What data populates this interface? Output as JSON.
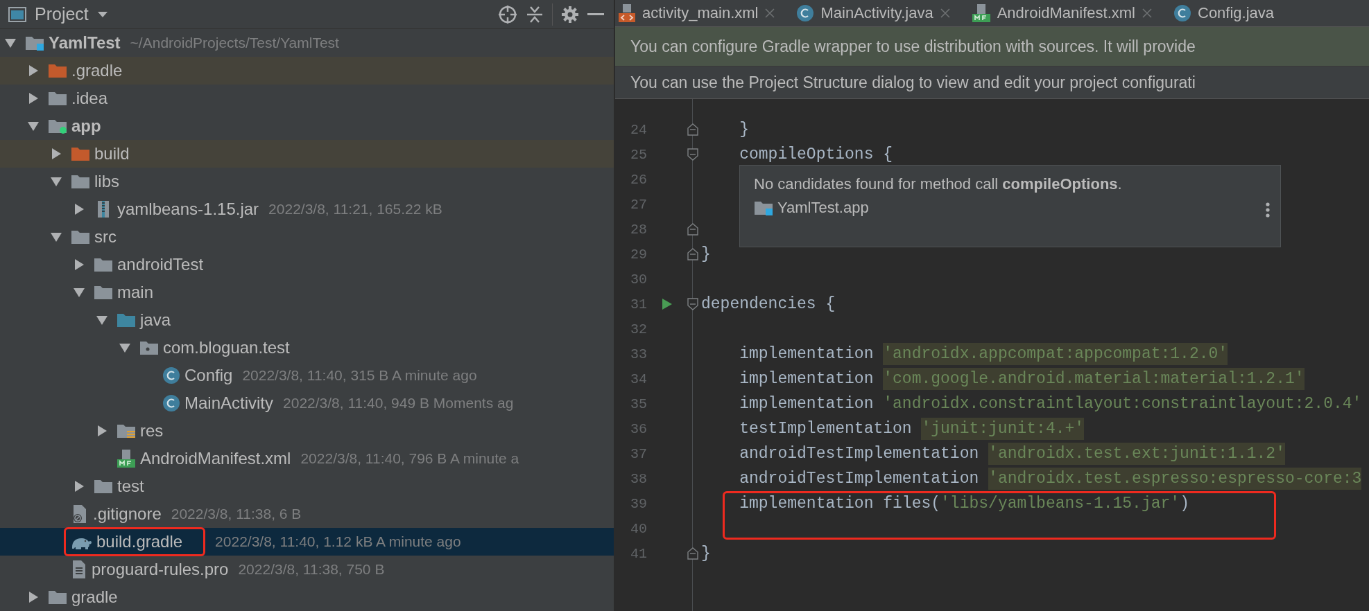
{
  "project_panel": {
    "title": "Project",
    "tree": [
      {
        "name": "YamlTest",
        "detail": "~/AndroidProjects/Test/YamlTest",
        "kind": "project-module",
        "expanded": true,
        "selected": false,
        "marked": false,
        "children": [
          {
            "name": ".gradle",
            "kind": "excluded-folder",
            "expanded": false,
            "selected": false,
            "marked": false
          },
          {
            "name": ".idea",
            "kind": "folder",
            "expanded": false,
            "selected": false,
            "marked": false
          },
          {
            "name": "app",
            "kind": "app-module",
            "expanded": true,
            "selected": false,
            "marked": false,
            "children": [
              {
                "name": "build",
                "kind": "excluded-folder",
                "expanded": false,
                "selected": false,
                "marked": false
              },
              {
                "name": "libs",
                "kind": "folder",
                "expanded": true,
                "selected": false,
                "marked": false,
                "children": [
                  {
                    "name": "yamlbeans-1.15.jar",
                    "detail": "2022/3/8, 11:21, 165.22 kB",
                    "kind": "jar",
                    "expanded": false,
                    "selected": false,
                    "marked": false
                  }
                ]
              },
              {
                "name": "src",
                "kind": "folder",
                "expanded": true,
                "selected": false,
                "marked": false,
                "children": [
                  {
                    "name": "androidTest",
                    "kind": "folder",
                    "expanded": false,
                    "selected": false,
                    "marked": false
                  },
                  {
                    "name": "main",
                    "kind": "folder",
                    "expanded": true,
                    "selected": false,
                    "marked": false,
                    "children": [
                      {
                        "name": "java",
                        "kind": "source-folder",
                        "expanded": true,
                        "selected": false,
                        "marked": false,
                        "children": [
                          {
                            "name": "com.bloguan.test",
                            "kind": "package",
                            "expanded": true,
                            "selected": false,
                            "marked": false,
                            "children": [
                              {
                                "name": "Config",
                                "detail": "2022/3/8, 11:40, 315 B A minute ago",
                                "kind": "class",
                                "selected": false,
                                "marked": false
                              },
                              {
                                "name": "MainActivity",
                                "detail": "2022/3/8, 11:40, 949 B Moments ag",
                                "kind": "class",
                                "selected": false,
                                "marked": false
                              }
                            ]
                          }
                        ]
                      },
                      {
                        "name": "res",
                        "kind": "resource-folder",
                        "expanded": false,
                        "selected": false,
                        "marked": false
                      },
                      {
                        "name": "AndroidManifest.xml",
                        "detail": "2022/3/8, 11:40, 796 B A minute a",
                        "kind": "manifest",
                        "selected": false,
                        "marked": false
                      }
                    ]
                  },
                  {
                    "name": "test",
                    "kind": "folder",
                    "expanded": false,
                    "selected": false,
                    "marked": false
                  }
                ]
              },
              {
                "name": ".gitignore",
                "detail": "2022/3/8, 11:38, 6 B",
                "kind": "ignore-file",
                "selected": false,
                "marked": false
              },
              {
                "name": "build.gradle",
                "detail": "2022/3/8, 11:40, 1.12 kB A minute ago",
                "kind": "gradle",
                "selected": true,
                "marked": true
              },
              {
                "name": "proguard-rules.pro",
                "detail": "2022/3/8, 11:38, 750 B",
                "kind": "text-file",
                "selected": false,
                "marked": false
              }
            ]
          },
          {
            "name": "gradle",
            "kind": "folder",
            "expanded": false,
            "selected": false,
            "marked": false
          }
        ]
      }
    ]
  },
  "editor": {
    "tabs": [
      {
        "label": "activity_main.xml",
        "kind": "xml",
        "closable": true
      },
      {
        "label": "MainActivity.java",
        "kind": "class",
        "closable": true
      },
      {
        "label": "AndroidManifest.xml",
        "kind": "manifest",
        "closable": true
      },
      {
        "label": "Config.java",
        "kind": "class",
        "closable": false
      }
    ],
    "banners": [
      {
        "text": "You can configure Gradle wrapper to use distribution with sources. It will provide",
        "kind": "suggestion"
      },
      {
        "text": "You can use the Project Structure dialog to view and edit your project configurati",
        "kind": "info"
      }
    ],
    "lines": [
      {
        "number": "24",
        "fold_end": true,
        "tokens": [
          {
            "text": "    }",
            "kind": "code"
          }
        ]
      },
      {
        "number": "25",
        "fold_start": true,
        "tokens": [
          {
            "text": "    compileOptions {",
            "kind": "code"
          }
        ]
      },
      {
        "number": "26"
      },
      {
        "number": "27"
      },
      {
        "number": "28",
        "fold_end": true
      },
      {
        "number": "29",
        "fold_end": true,
        "tokens": [
          {
            "text": "}",
            "kind": "code"
          }
        ]
      },
      {
        "number": "30"
      },
      {
        "number": "31",
        "fold_start": true,
        "run": true,
        "tokens": [
          {
            "text": "dependencies {",
            "kind": "code"
          }
        ]
      },
      {
        "number": "32"
      },
      {
        "number": "33",
        "tokens": [
          {
            "text": "    implementation ",
            "kind": "code"
          },
          {
            "text": "'androidx.appcompat:appcompat:1.2.0'",
            "kind": "string-flagged"
          }
        ]
      },
      {
        "number": "34",
        "tokens": [
          {
            "text": "    implementation ",
            "kind": "code"
          },
          {
            "text": "'com.google.android.material:material:1.2.1'",
            "kind": "string-flagged"
          }
        ]
      },
      {
        "number": "35",
        "tokens": [
          {
            "text": "    implementation ",
            "kind": "code"
          },
          {
            "text": "'androidx.constraintlayout:constraintlayout:2.0.4'",
            "kind": "string"
          }
        ]
      },
      {
        "number": "36",
        "tokens": [
          {
            "text": "    testImplementation ",
            "kind": "code"
          },
          {
            "text": "'junit:junit:4.+'",
            "kind": "string-flagged"
          }
        ]
      },
      {
        "number": "37",
        "tokens": [
          {
            "text": "    androidTestImplementation ",
            "kind": "code"
          },
          {
            "text": "'androidx.test.ext:junit:1.1.2'",
            "kind": "string-flagged"
          }
        ]
      },
      {
        "number": "38",
        "tokens": [
          {
            "text": "    androidTestImplementation ",
            "kind": "code"
          },
          {
            "text": "'androidx.test.espresso:espresso-core:3",
            "kind": "string-flagged"
          }
        ]
      },
      {
        "number": "39",
        "marked": true,
        "tokens": [
          {
            "text": "    implementation files(",
            "kind": "code"
          },
          {
            "text": "'libs/yamlbeans-1.15.jar'",
            "kind": "string"
          },
          {
            "text": ")",
            "kind": "code"
          }
        ]
      },
      {
        "number": "40"
      },
      {
        "number": "41",
        "fold_end": true,
        "tokens": [
          {
            "text": "}",
            "kind": "code"
          }
        ]
      }
    ],
    "popup": {
      "message": "No candidates found for method call **compileOptions**.",
      "module": "YamlTest.app"
    }
  }
}
